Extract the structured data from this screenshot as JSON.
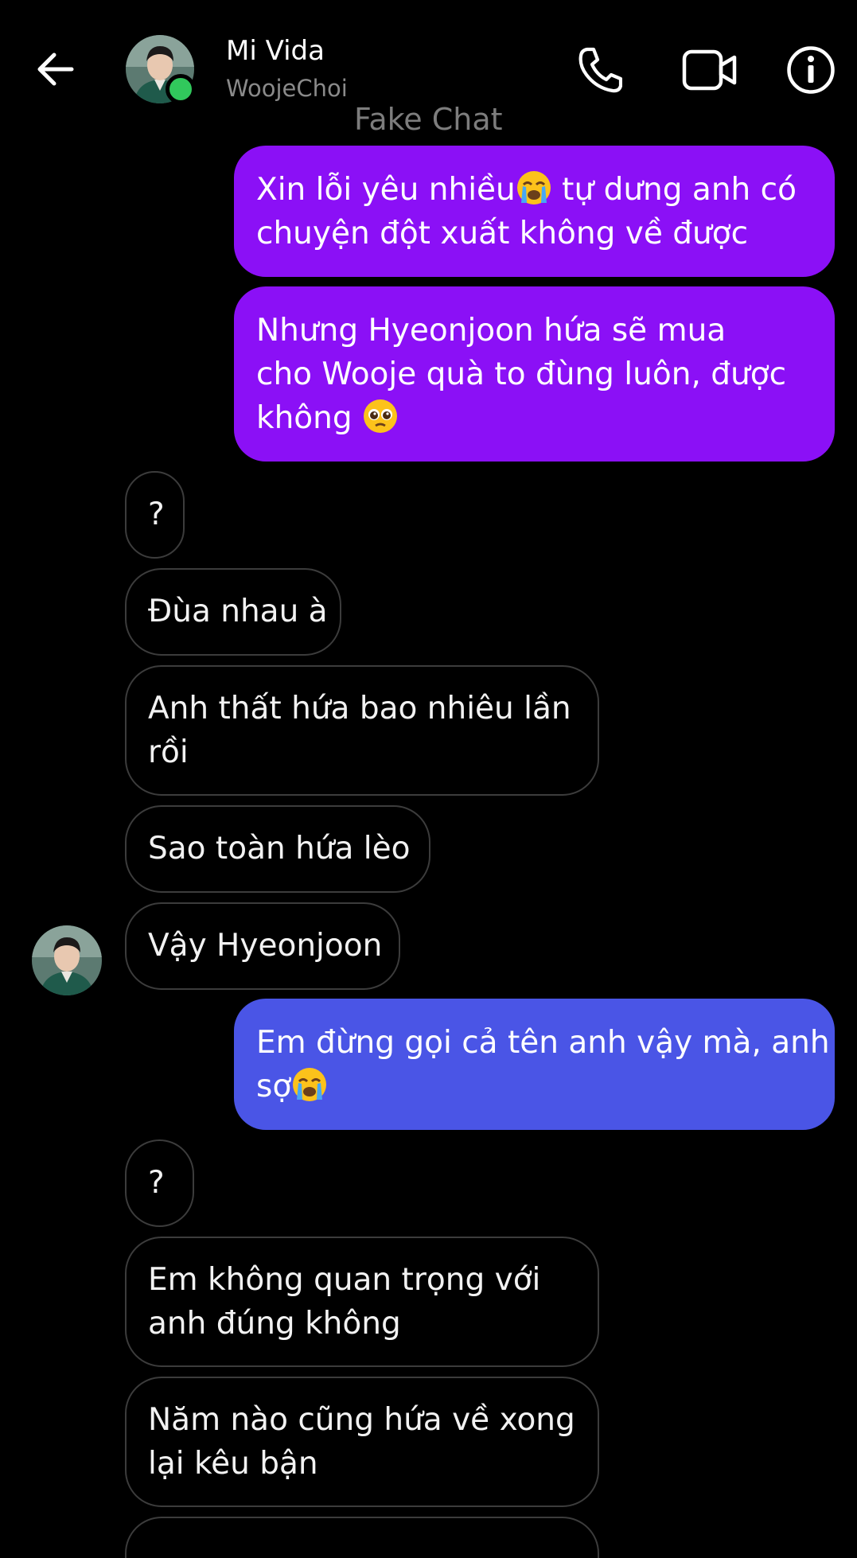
{
  "header": {
    "back_icon": "arrow-left-icon",
    "contact_name": "Mi Vida",
    "contact_username": "WoojeChoi",
    "online": true,
    "watermark": "Fake Chat",
    "call_icon": "phone-icon",
    "video_icon": "video-camera-icon",
    "info_icon": "info-circle-icon"
  },
  "colors": {
    "background": "#000000",
    "outgoing_purple": "#8b10f6",
    "outgoing_blue": "#4a55e6",
    "incoming_border": "#3c3c3c",
    "online_dot": "#31c85c",
    "secondary_text": "#8a8a8a"
  },
  "messages": [
    {
      "dir": "out",
      "lines": [
        "Xin lỗi yêu nhiều",
        " tự dưng anh có",
        "chuyện đột xuất không về được"
      ],
      "emoji": "loudly-crying-face"
    },
    {
      "dir": "out",
      "lines": [
        "Nhưng Hyeonjoon hứa sẽ mua",
        "cho Wooje quà to đùng luôn, được",
        "không "
      ],
      "emoji": "pleading-face"
    },
    {
      "dir": "in",
      "lines": [
        "?"
      ]
    },
    {
      "dir": "in",
      "lines": [
        "Đùa nhau à"
      ]
    },
    {
      "dir": "in",
      "lines": [
        "Anh thất hứa bao nhiêu lần",
        "rồi"
      ]
    },
    {
      "dir": "in",
      "lines": [
        "Sao toàn hứa lèo"
      ]
    },
    {
      "dir": "in",
      "lines": [
        "Vậy Hyeonjoon"
      ]
    },
    {
      "dir": "out",
      "lines": [
        "Em đừng gọi cả tên anh vậy mà, anh",
        "sợ"
      ],
      "emoji": "loudly-crying-face"
    },
    {
      "dir": "in",
      "lines": [
        "?"
      ]
    },
    {
      "dir": "in",
      "lines": [
        "Em không quan trọng với",
        "anh đúng không"
      ]
    },
    {
      "dir": "in",
      "lines": [
        "Năm nào cũng hứa về xong",
        "lại kêu bận"
      ]
    }
  ]
}
